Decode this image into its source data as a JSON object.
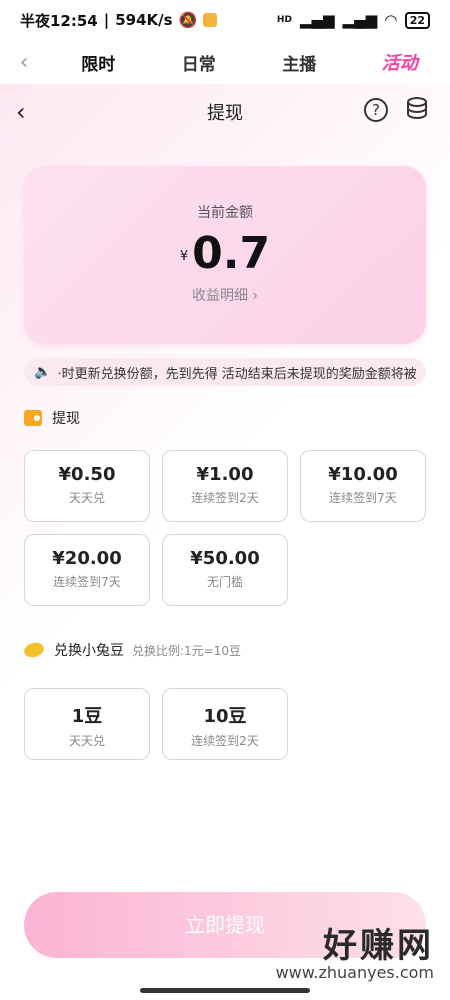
{
  "status_bar": {
    "time": "半夜12:54",
    "speed": "594K/s",
    "signal": "HD",
    "battery": "22"
  },
  "top_tabs": {
    "items": [
      {
        "label": "限时"
      },
      {
        "label": "日常"
      },
      {
        "label": "主播"
      },
      {
        "label": "活动"
      }
    ],
    "active_index": 0
  },
  "header": {
    "title": "提现",
    "help_symbol": "?"
  },
  "balance": {
    "label": "当前金额",
    "currency": "¥",
    "amount": "0.7",
    "detail_link": "收益明细 ›"
  },
  "notice": {
    "text": "·时更新兑换份额，先到先得 活动结束后未提现的奖励金额将被"
  },
  "withdraw_section": {
    "title": "提现",
    "options": [
      {
        "value": "¥0.50",
        "condition": "天天兑"
      },
      {
        "value": "¥1.00",
        "condition": "连续签到2天"
      },
      {
        "value": "¥10.00",
        "condition": "连续签到7天"
      },
      {
        "value": "¥20.00",
        "condition": "连续签到7天"
      },
      {
        "value": "¥50.00",
        "condition": "无门槛"
      }
    ]
  },
  "exchange_section": {
    "title": "兑换小兔豆",
    "hint": "兑换比例:1元=10豆",
    "options": [
      {
        "value": "1豆",
        "condition": "天天兑"
      },
      {
        "value": "10豆",
        "condition": "连续签到2天"
      }
    ]
  },
  "submit_button": {
    "label": "立即提现"
  },
  "watermark": {
    "big": "好赚网",
    "small": "www.zhuanyes.com"
  },
  "colors": {
    "accent": "#ff3ea5",
    "button_start": "#fbb4d3",
    "card_bg": "#fde1ee"
  }
}
